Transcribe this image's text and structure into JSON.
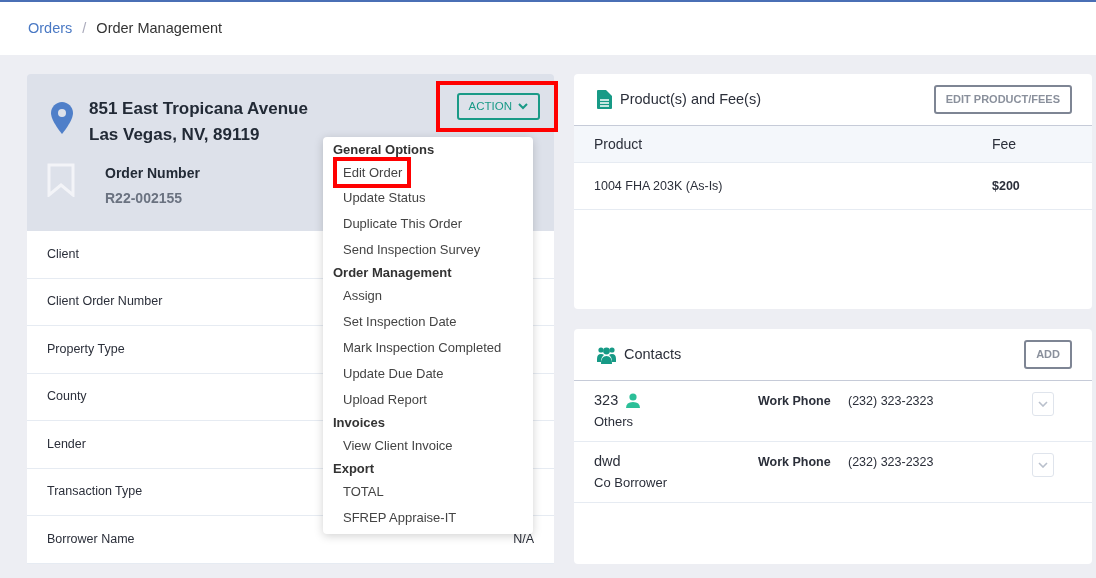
{
  "breadcrumb": [
    {
      "label": "Orders",
      "link": true
    },
    {
      "label": "Order Management",
      "link": false
    }
  ],
  "breadcrumb_separator": "/",
  "order": {
    "address_line1": "851 East Tropicana Avenue",
    "address_line2": "Las Vegas, NV, 89119",
    "number_label": "Order Number",
    "number": "R22-002155",
    "action_button": {
      "label": "ACTION",
      "highlighted": true
    },
    "details": [
      {
        "label": "Client"
      },
      {
        "label": "Client Order Number"
      },
      {
        "label": "Property Type"
      },
      {
        "label": "County"
      },
      {
        "label": "Lender"
      },
      {
        "label": "Transaction Type"
      },
      {
        "label": "Borrower Name",
        "value": "N/A"
      }
    ]
  },
  "action_menu": [
    {
      "kind": "header",
      "label": "General Options"
    },
    {
      "kind": "item",
      "label": "Edit Order",
      "highlighted": true
    },
    {
      "kind": "item",
      "label": "Update Status",
      "highlighted": false
    },
    {
      "kind": "item",
      "label": "Duplicate This Order",
      "highlighted": false
    },
    {
      "kind": "item",
      "label": "Send Inspection Survey",
      "highlighted": false
    },
    {
      "kind": "header",
      "label": "Order Management"
    },
    {
      "kind": "item",
      "label": "Assign",
      "highlighted": false
    },
    {
      "kind": "item",
      "label": "Set Inspection Date",
      "highlighted": false
    },
    {
      "kind": "item",
      "label": "Mark Inspection Completed",
      "highlighted": false
    },
    {
      "kind": "item",
      "label": "Update Due Date",
      "highlighted": false
    },
    {
      "kind": "item",
      "label": "Upload Report",
      "highlighted": false
    },
    {
      "kind": "header",
      "label": "Invoices"
    },
    {
      "kind": "item",
      "label": "View Client Invoice",
      "highlighted": false
    },
    {
      "kind": "header",
      "label": "Export"
    },
    {
      "kind": "item",
      "label": "TOTAL",
      "highlighted": false
    },
    {
      "kind": "item",
      "label": "SFREP Appraise-IT",
      "highlighted": false
    }
  ],
  "products": {
    "title": "Product(s) and Fee(s)",
    "button": "EDIT PRODUCT/FEES",
    "columns": [
      "Product",
      "Fee"
    ],
    "rows": [
      [
        "1004 FHA 203K (As-Is)",
        "$200"
      ]
    ]
  },
  "contacts": {
    "title": "Contacts",
    "button": "ADD",
    "items": [
      {
        "name": "323",
        "primary": true,
        "role": "Others",
        "phone_label": "Work Phone",
        "phone": "(232) 323-2323"
      },
      {
        "name": "dwd",
        "primary": false,
        "role": "Co Borrower",
        "phone_label": "Work Phone",
        "phone": "(232) 323-2323"
      }
    ]
  }
}
